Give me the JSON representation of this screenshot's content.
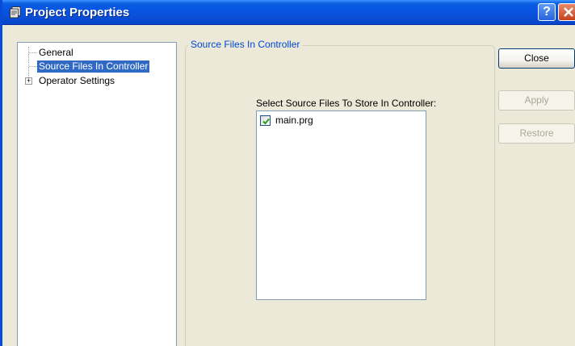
{
  "window": {
    "title": "Project Properties",
    "help_glyph": "?",
    "close_glyph": "✕"
  },
  "tree": {
    "items": [
      {
        "label": "General",
        "selected": false
      },
      {
        "label": "Source Files In Controller",
        "selected": true
      },
      {
        "label": "Operator Settings",
        "selected": false,
        "expander": "+"
      }
    ]
  },
  "group": {
    "legend": "Source Files In Controller",
    "list_label": "Select Source Files To Store In Controller:",
    "files": [
      {
        "name": "main.prg",
        "checked": true
      }
    ]
  },
  "buttons": {
    "close_label": "Close",
    "apply_label": "Apply",
    "restore_label": "Restore",
    "apply_enabled": false,
    "restore_enabled": false
  },
  "colors": {
    "titlebar": "#0854e3",
    "selection": "#316ac5",
    "legend_text": "#0046d5",
    "checkmark": "#21a121"
  },
  "icons": {
    "window_icon": "properties-window-icon",
    "help": "help-icon",
    "close": "close-icon",
    "expander": "plus-expander-icon",
    "checkbox": "checkmark-icon"
  }
}
